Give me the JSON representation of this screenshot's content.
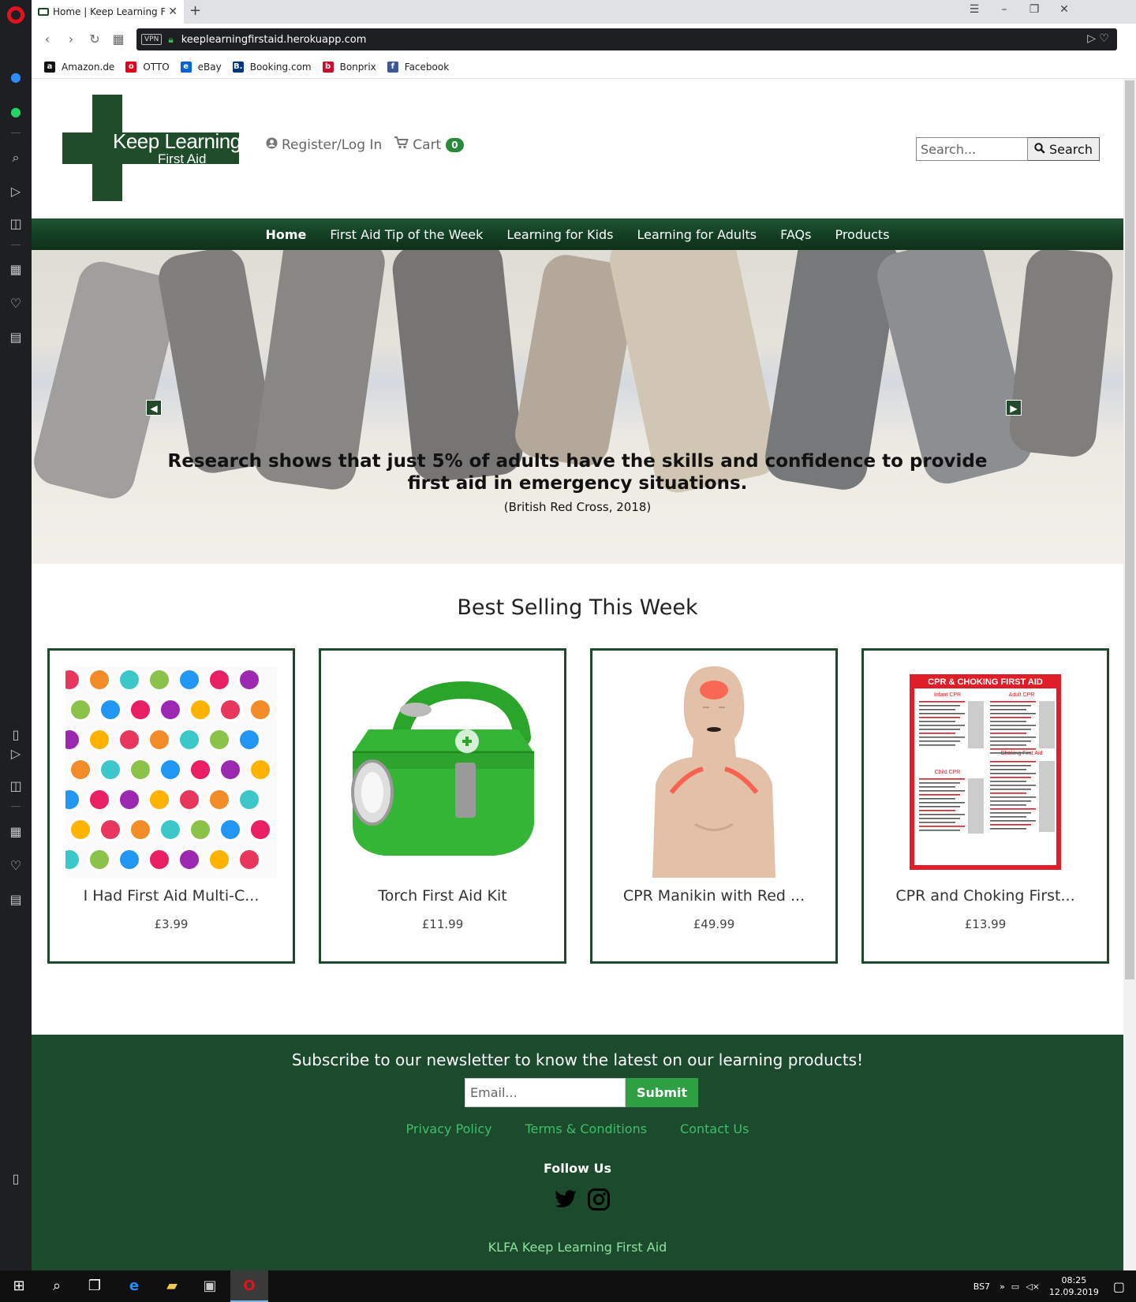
{
  "browser": {
    "tab_title": "Home | Keep Learning Firs",
    "url": "keeplearningfirstaid.herokuapp.com",
    "vpn_label": "VPN",
    "bookmarks": [
      {
        "label": "Amazon.de",
        "icon": "a",
        "color": "#111111"
      },
      {
        "label": "OTTO",
        "icon": "o",
        "color": "#e2001a"
      },
      {
        "label": "eBay",
        "icon": "e",
        "color": "#0064d2"
      },
      {
        "label": "Booking.com",
        "icon": "B.",
        "color": "#003580"
      },
      {
        "label": "Bonprix",
        "icon": "b",
        "color": "#c8102e"
      },
      {
        "label": "Facebook",
        "icon": "f",
        "color": "#3b5998"
      }
    ]
  },
  "header": {
    "logo_line1": "Keep Learning",
    "logo_line2": "First Aid",
    "register_label": "Register/Log In",
    "cart_label": "Cart",
    "cart_count": "0",
    "search_placeholder": "Search...",
    "search_button": "Search"
  },
  "nav": {
    "items": [
      "Home",
      "First Aid Tip of the Week",
      "Learning for Kids",
      "Learning for Adults",
      "FAQs",
      "Products"
    ],
    "active": "Home"
  },
  "hero": {
    "quote": "Research shows that just 5% of adults have the skills and confidence to provide first aid in emergency situations.",
    "source": "(British Red Cross, 2018)"
  },
  "best_selling": {
    "title": "Best Selling This Week",
    "products": [
      {
        "name": "I Had First Aid Multi-C...",
        "price": "£3.99",
        "image": "sticker-sheet-image"
      },
      {
        "name": "Torch First Aid Kit",
        "price": "£11.99",
        "image": "green-first-aid-box-image"
      },
      {
        "name": "CPR Manikin with Red ...",
        "price": "£49.99",
        "image": "cpr-manikin-image"
      },
      {
        "name": "CPR and Choking First...",
        "price": "£13.99",
        "image": "cpr-poster-image"
      }
    ]
  },
  "poster": {
    "title": "CPR & CHOKING FIRST AID",
    "col1": "Infant CPR",
    "col2": "Adult CPR",
    "child": "Child CPR",
    "choking": "Choking First Aid"
  },
  "footer": {
    "newsletter_title": "Subscribe to our newsletter to know the latest on our learning products!",
    "email_placeholder": "Email...",
    "submit_label": "Submit",
    "links": [
      "Privacy Policy",
      "Terms & Conditions",
      "Contact Us"
    ],
    "follow_title": "Follow Us",
    "brand": "KLFA Keep Learning First Aid"
  },
  "taskbar": {
    "lang": "BS7",
    "time": "08:25",
    "date": "12.09.2019"
  },
  "colors": {
    "brand_green": "#1b4a2c",
    "accent_green": "#2ea043",
    "link_green": "#3fbf6a"
  }
}
